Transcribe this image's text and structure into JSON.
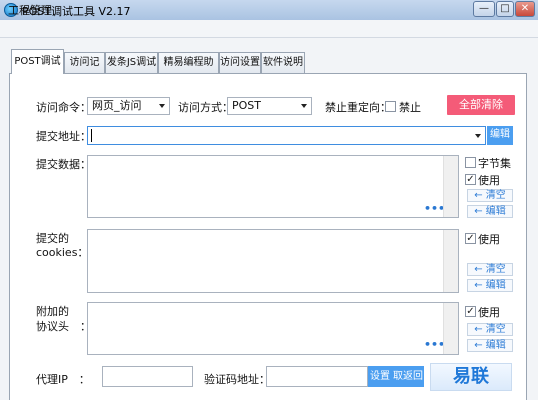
{
  "window": {
    "title": "POST调试工具 V2.17",
    "minimize": "—",
    "maximize": "□",
    "close": "✕"
  },
  "menu": {
    "items": [
      "工程管理"
    ]
  },
  "tabs": [
    "POST调试",
    "访问记录",
    "发条JS调试",
    "精易编程助手",
    "访问设置",
    "软件说明"
  ],
  "form": {
    "command_label": "访问命令：",
    "command_value": "网页_访问",
    "method_label": "访问方式：",
    "method_value": "POST",
    "redirect_label": "禁止重定向：",
    "redirect_option": "禁止",
    "clear_all": "全部清除",
    "url_label": "提交地址：",
    "url_value": "",
    "edit": "编辑",
    "data_label": "提交数据：",
    "byteset_label": "字节集",
    "use_label": "使用",
    "clear_link": "← 清空",
    "edit_link": "← 编辑",
    "cookies_label_1": "提交的",
    "cookies_label_2": "cookies：",
    "headers_label_1": "附加的",
    "headers_label_2": "协议头　：",
    "dots": "•••",
    "proxy_label": "代理IP　：",
    "proxy_value": "",
    "captcha_label": "验证码地址：",
    "captcha_value": "",
    "settings_btn": "设置",
    "return_btn": "取返回",
    "logo_text": "易联"
  },
  "colors": {
    "accent_red": "#f45b78",
    "accent_blue": "#4b9ef0",
    "title_bar": "#c6d8ee"
  }
}
